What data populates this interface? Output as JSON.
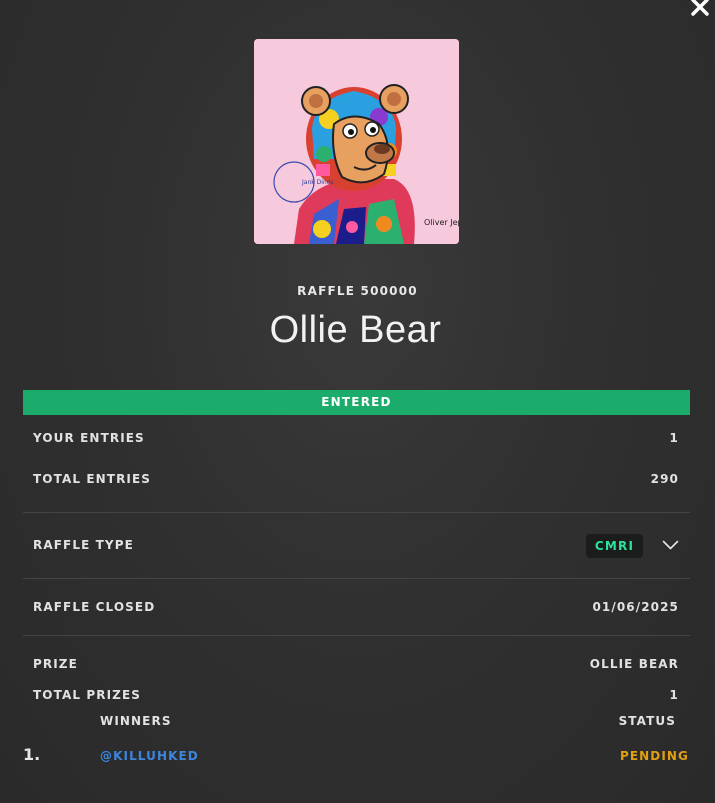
{
  "raffle": {
    "number_label": "RAFFLE 500000",
    "title": "Ollie Bear",
    "status": "ENTERED",
    "image_signature": "Oliver Jepson",
    "image_stamp": "Jank Dinos"
  },
  "details": {
    "your_entries_label": "YOUR ENTRIES",
    "your_entries_value": "1",
    "total_entries_label": "TOTAL ENTRIES",
    "total_entries_value": "290",
    "raffle_type_label": "RAFFLE TYPE",
    "raffle_type_value": "CMRI",
    "raffle_closed_label": "RAFFLE CLOSED",
    "raffle_closed_value": "01/06/2025",
    "prize_label": "PRIZE",
    "prize_value": "OLLIE BEAR",
    "total_prizes_label": "TOTAL PRIZES",
    "total_prizes_value": "1"
  },
  "winners": {
    "winners_header": "WINNERS",
    "status_header": "STATUS",
    "rows": [
      {
        "rank": "1.",
        "name": "@KILLUHKED",
        "status": "PENDING"
      }
    ]
  },
  "colors": {
    "entered_green": "#1bab6b",
    "badge_text": "#2fe09a",
    "link_blue": "#3d86e0",
    "pending_amber": "#e0a010",
    "background": "#303030"
  },
  "icons": {
    "close": "close-icon",
    "chevron": "chevron-down-icon"
  }
}
